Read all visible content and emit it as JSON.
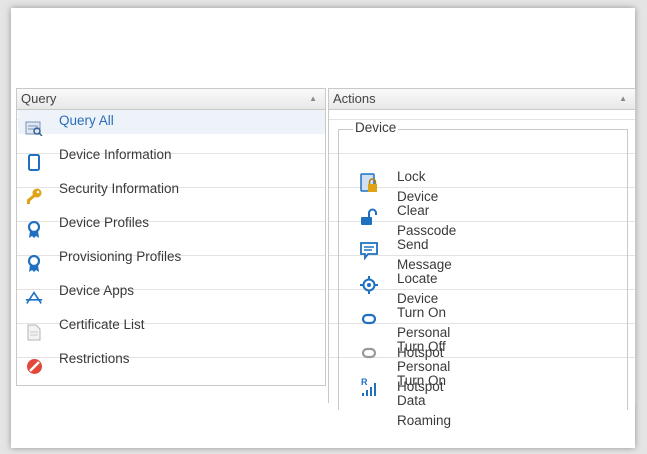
{
  "query": {
    "header": "Query",
    "items": [
      {
        "label": "Query All",
        "icon": "query-all-icon",
        "selected": true
      },
      {
        "label": "Device Information",
        "icon": "device-icon"
      },
      {
        "label": "Security Information",
        "icon": "key-icon"
      },
      {
        "label": "Device Profiles",
        "icon": "ribbon-icon"
      },
      {
        "label": "Provisioning Profiles",
        "icon": "ribbon-icon"
      },
      {
        "label": "Device Apps",
        "icon": "apps-icon"
      },
      {
        "label": "Certificate List",
        "icon": "document-icon"
      },
      {
        "label": "Restrictions",
        "icon": "no-entry-icon"
      }
    ]
  },
  "actions": {
    "header": "Actions",
    "group_label": "Device",
    "items": [
      {
        "label": "Lock Device",
        "icon": "lock-device-icon"
      },
      {
        "label": "Clear Passcode",
        "icon": "unlock-icon"
      },
      {
        "label": "Send Message",
        "icon": "message-icon"
      },
      {
        "label": "Locate Device",
        "icon": "crosshair-icon"
      },
      {
        "label": "Turn On Personal Hotspot",
        "icon": "hotspot-on-icon"
      },
      {
        "label": "Turn Off Personal Hotspot",
        "icon": "hotspot-off-icon"
      },
      {
        "label": "Turn On Data Roaming",
        "icon": "roaming-icon"
      }
    ]
  },
  "colors": {
    "accent": "#2a6db8",
    "icon_blue": "#1f70c1",
    "key_yellow": "#e0a316",
    "restrict_red": "#e2483b"
  }
}
